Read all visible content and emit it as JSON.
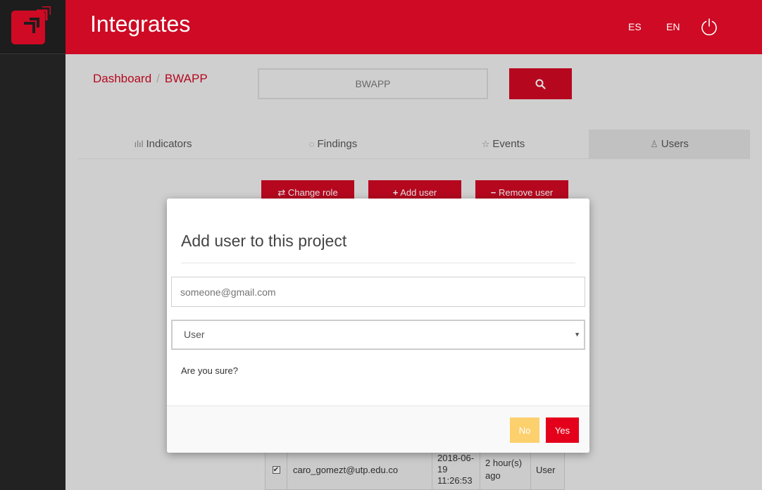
{
  "header": {
    "app_title": "Integrates",
    "lang_es": "ES",
    "lang_en": "EN",
    "power_icon": "power-icon",
    "logo_icon": "fluid-attacks-logo"
  },
  "breadcrumb": {
    "dashboard": "Dashboard",
    "separator": "/",
    "project": "BWAPP"
  },
  "search": {
    "value": "BWAPP",
    "button_icon": "search-icon"
  },
  "tabs": [
    {
      "label": "Indicators",
      "icon": "bar-chart-icon"
    },
    {
      "label": "Findings",
      "icon": "lightbulb-icon"
    },
    {
      "label": "Events",
      "icon": "star-icon"
    },
    {
      "label": "Users",
      "icon": "users-icon",
      "active": true
    }
  ],
  "actions": {
    "change_role": "Change role",
    "add_user": "Add user",
    "remove_user": "Remove user"
  },
  "table": {
    "row": {
      "email": "caro_gomezt@utp.edu.co",
      "date": "2018-06-19 11:26:53",
      "last_login": "2 hour(s) ago",
      "role": "User",
      "checked": true
    }
  },
  "modal": {
    "title": "Add user to this project",
    "email_placeholder": "someone@gmail.com",
    "role_selected": "User",
    "confirm_text": "Are you sure?",
    "no_label": "No",
    "yes_label": "Yes"
  },
  "colors": {
    "brand": "#ce0a24",
    "no_button": "#fdd06e",
    "yes_button": "#e4001b"
  }
}
